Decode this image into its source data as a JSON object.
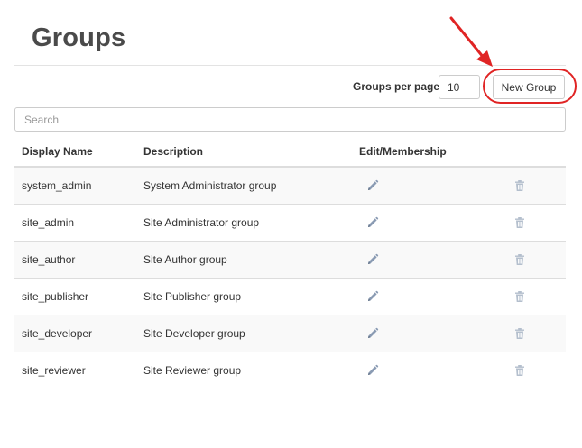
{
  "page": {
    "title": "Groups"
  },
  "toolbar": {
    "per_page_label": "Groups per page:",
    "per_page_value": "10",
    "new_group_label": "New Group"
  },
  "search": {
    "placeholder": "Search"
  },
  "table": {
    "headers": {
      "display_name": "Display Name",
      "description": "Description",
      "edit_membership": "Edit/Membership"
    },
    "rows": [
      {
        "display_name": "system_admin",
        "description": "System Administrator group"
      },
      {
        "display_name": "site_admin",
        "description": "Site Administrator group"
      },
      {
        "display_name": "site_author",
        "description": "Site Author group"
      },
      {
        "display_name": "site_publisher",
        "description": "Site Publisher group"
      },
      {
        "display_name": "site_developer",
        "description": "Site Developer group"
      },
      {
        "display_name": "site_reviewer",
        "description": "Site Reviewer group"
      }
    ]
  },
  "icons": {
    "row_edit": "pencil-icon",
    "row_delete": "trash-icon",
    "annotation": "red-arrow"
  },
  "colors": {
    "annotation": "#e02424",
    "icon": "#8a9bb3",
    "stripe": "#f9f9f9"
  }
}
